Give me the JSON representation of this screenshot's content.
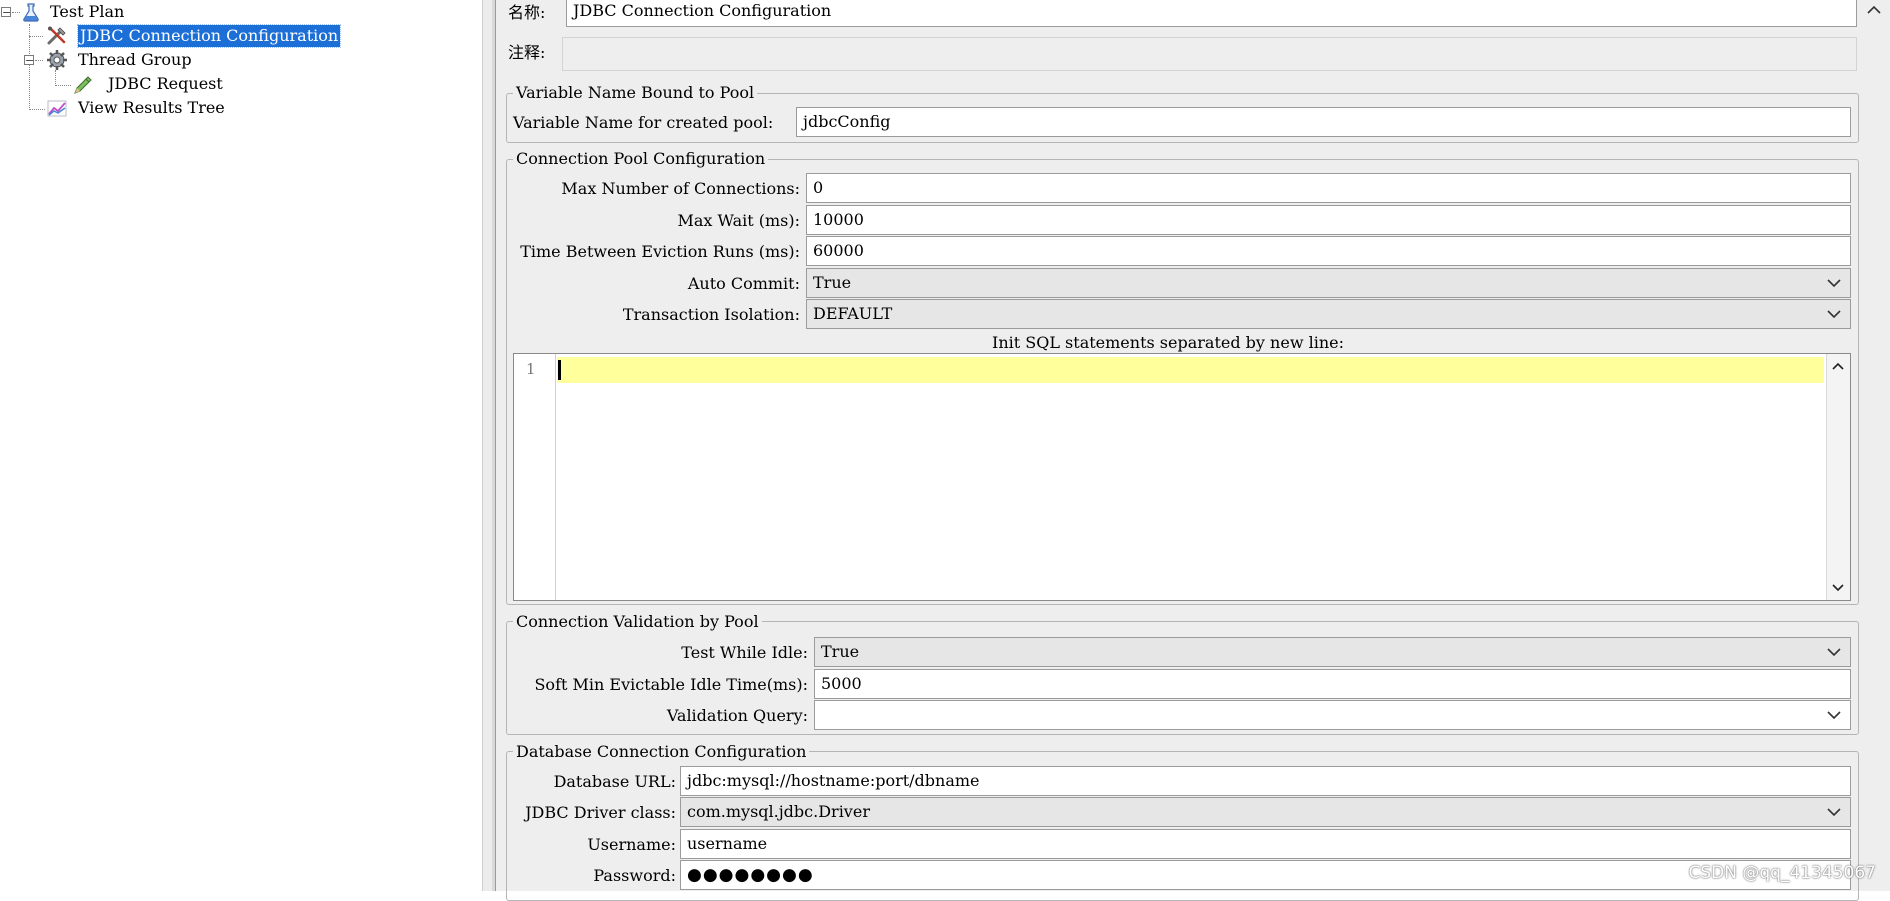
{
  "tree": {
    "items": [
      {
        "label": "Test Plan",
        "icon": "test-plan-flask-icon"
      },
      {
        "label": "JDBC Connection Configuration",
        "icon": "jdbc-config-tools-icon",
        "selected": true
      },
      {
        "label": "Thread Group",
        "icon": "thread-group-gear-icon"
      },
      {
        "label": "JDBC Request",
        "icon": "jdbc-request-pen-icon"
      },
      {
        "label": "View Results Tree",
        "icon": "results-tree-chart-icon"
      }
    ]
  },
  "form": {
    "name_label": "名称:",
    "name_value": "JDBC Connection Configuration",
    "comment_label": "注释:",
    "comment_value": ""
  },
  "variable_group": {
    "title": "Variable Name Bound to Pool",
    "pool_label": "Variable Name for created pool:",
    "pool_value": "jdbcConfig"
  },
  "pool_group": {
    "title": "Connection Pool Configuration",
    "max_conn_label": "Max Number of Connections:",
    "max_conn_value": "0",
    "max_wait_label": "Max Wait (ms):",
    "max_wait_value": "10000",
    "eviction_label": "Time Between Eviction Runs (ms):",
    "eviction_value": "60000",
    "auto_commit_label": "Auto Commit:",
    "auto_commit_value": "True",
    "isolation_label": "Transaction Isolation:",
    "isolation_value": "DEFAULT",
    "init_sql_label": "Init SQL statements separated by new line:",
    "line_number": "1"
  },
  "validation_group": {
    "title": "Connection Validation by Pool",
    "test_idle_label": "Test While Idle:",
    "test_idle_value": "True",
    "soft_min_label": "Soft Min Evictable Idle Time(ms):",
    "soft_min_value": "5000",
    "query_label": "Validation Query:",
    "query_value": ""
  },
  "db_group": {
    "title": "Database Connection Configuration",
    "url_label": "Database URL:",
    "url_value": "jdbc:mysql://hostname:port/dbname",
    "driver_label": "JDBC Driver class:",
    "driver_value": "com.mysql.jdbc.Driver",
    "username_label": "Username:",
    "username_value": "username",
    "password_label": "Password:",
    "password_value": "●●●●●●●●"
  },
  "watermark": "CSDN @qq_41345067",
  "colors": {
    "selection": "#1d6fd8",
    "current_line": "#ffff9c",
    "panel_bg": "#eeeeee"
  }
}
